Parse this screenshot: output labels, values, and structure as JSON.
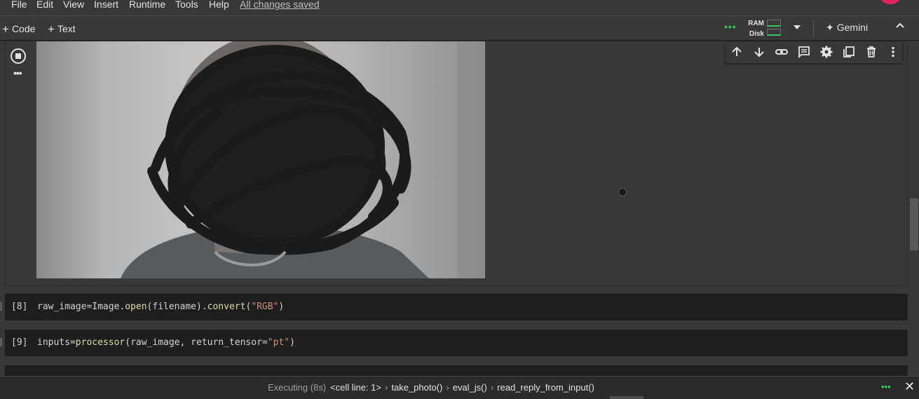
{
  "menu": {
    "items": [
      "File",
      "Edit",
      "View",
      "Insert",
      "Runtime",
      "Tools",
      "Help"
    ],
    "save_status": "All changes saved"
  },
  "toolbar": {
    "add_code": "Code",
    "add_text": "Text",
    "resource_indicator": "•••",
    "ram_label": "RAM",
    "disk_label": "Disk",
    "gemini_label": "Gemini",
    "accent_color": "#34c759"
  },
  "output_cell": {
    "run_state": "executing",
    "image_content": "webcam photo with face scribbled out"
  },
  "cell_toolbar": {
    "icons": [
      "arrow-up-icon",
      "arrow-down-icon",
      "link-icon",
      "comment-icon",
      "gear-icon",
      "mirror-cell-icon",
      "trash-icon",
      "more-vert-icon"
    ]
  },
  "code_cells": [
    {
      "number": "[8]",
      "tokens": [
        {
          "t": "raw_image=Image.",
          "c": ""
        },
        {
          "t": "open",
          "c": "fn"
        },
        {
          "t": "(filename).",
          "c": ""
        },
        {
          "t": "convert",
          "c": "fn"
        },
        {
          "t": "(",
          "c": ""
        },
        {
          "t": "\"RGB\"",
          "c": "str"
        },
        {
          "t": ")",
          "c": ""
        }
      ]
    },
    {
      "number": "[9]",
      "tokens": [
        {
          "t": "inputs=",
          "c": ""
        },
        {
          "t": "processor",
          "c": "fn"
        },
        {
          "t": "(raw_image, return_tensor=",
          "c": ""
        },
        {
          "t": "\"pt\"",
          "c": "str"
        },
        {
          "t": ")",
          "c": ""
        }
      ]
    }
  ],
  "status": {
    "executing": "Executing (8s)",
    "breadcrumbs": [
      "<cell line: 1>",
      "take_photo()",
      "eval_js()",
      "read_reply_from_input()"
    ],
    "dots": "•••"
  }
}
